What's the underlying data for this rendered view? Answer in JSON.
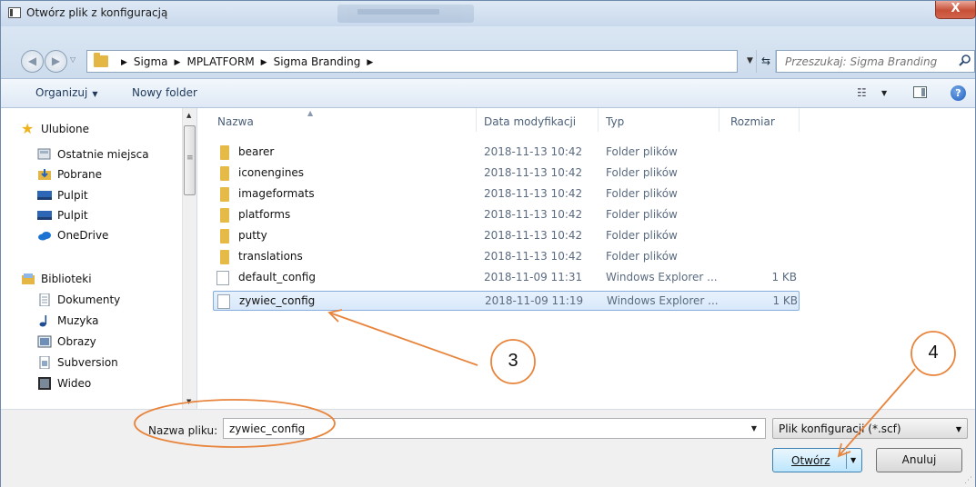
{
  "window": {
    "title": "Otwórz plik z konfiguracją",
    "close_glyph": "X"
  },
  "nav": {
    "breadcrumbs": [
      "Sigma",
      "MPLATFORM",
      "Sigma Branding"
    ],
    "search_placeholder": "Przeszukaj: Sigma Branding"
  },
  "toolbar": {
    "organize": "Organizuj",
    "new_folder": "Nowy folder"
  },
  "sidebar": {
    "favorites": "Ulubione",
    "favorite_items": [
      "Ostatnie miejsca",
      "Pobrane",
      "Pulpit",
      "Pulpit",
      "OneDrive"
    ],
    "libraries": "Biblioteki",
    "library_items": [
      "Dokumenty",
      "Muzyka",
      "Obrazy",
      "Subversion",
      "Wideo"
    ]
  },
  "columns": {
    "name": "Nazwa",
    "date": "Data modyfikacji",
    "type": "Typ",
    "size": "Rozmiar"
  },
  "files": [
    {
      "name": "bearer",
      "date": "2018-11-13 10:42",
      "type": "Folder plików",
      "size": "",
      "kind": "folder"
    },
    {
      "name": "iconengines",
      "date": "2018-11-13 10:42",
      "type": "Folder plików",
      "size": "",
      "kind": "folder"
    },
    {
      "name": "imageformats",
      "date": "2018-11-13 10:42",
      "type": "Folder plików",
      "size": "",
      "kind": "folder"
    },
    {
      "name": "platforms",
      "date": "2018-11-13 10:42",
      "type": "Folder plików",
      "size": "",
      "kind": "folder"
    },
    {
      "name": "putty",
      "date": "2018-11-13 10:42",
      "type": "Folder plików",
      "size": "",
      "kind": "folder"
    },
    {
      "name": "translations",
      "date": "2018-11-13 10:42",
      "type": "Folder plików",
      "size": "",
      "kind": "folder"
    },
    {
      "name": "default_config",
      "date": "2018-11-09 11:31",
      "type": "Windows Explorer ...",
      "size": "1 KB",
      "kind": "file"
    },
    {
      "name": "zywiec_config",
      "date": "2018-11-09 11:19",
      "type": "Windows Explorer ...",
      "size": "1 KB",
      "kind": "file",
      "selected": true
    }
  ],
  "bottom": {
    "filename_label": "Nazwa pliku:",
    "filename_value": "zywiec_config",
    "filter": "Plik konfiguracji (*.scf)",
    "open": "Otwórz",
    "cancel": "Anuluj"
  },
  "annotations": {
    "step3": "3",
    "step4": "4",
    "color": "#e8843c"
  }
}
